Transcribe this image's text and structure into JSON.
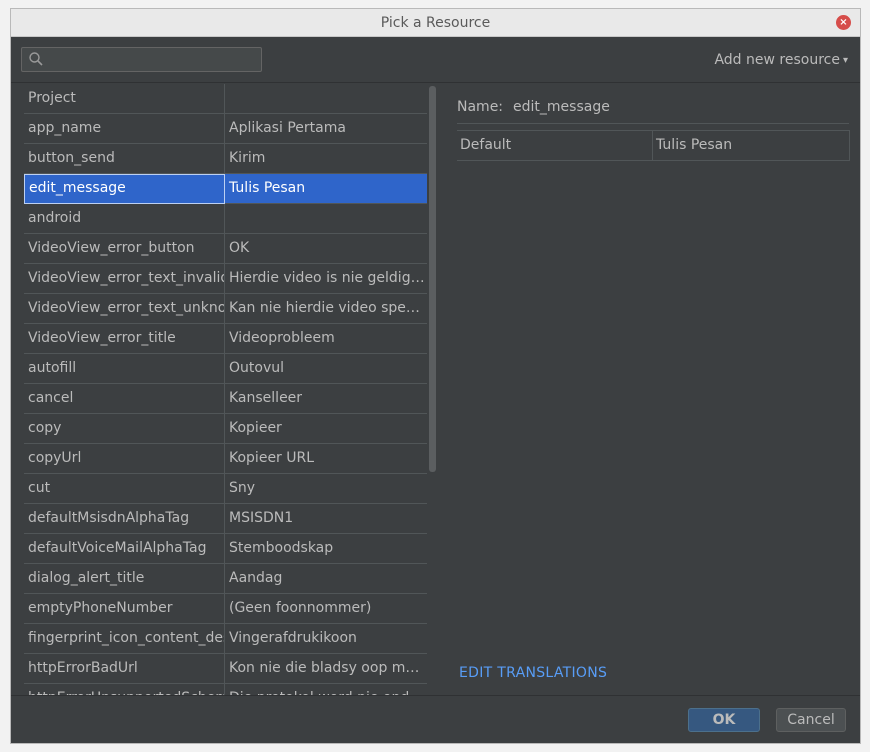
{
  "window": {
    "title": "Pick a Resource",
    "close_symbol": "×"
  },
  "search": {
    "placeholder": "",
    "value": ""
  },
  "add_resource_label": "Add new resource",
  "caret": "▾",
  "resource_table": {
    "group_header": "Project",
    "rows": [
      {
        "key": "app_name",
        "value": "Aplikasi Pertama"
      },
      {
        "key": "button_send",
        "value": "Kirim"
      },
      {
        "key": "edit_message",
        "value": "Tulis Pesan"
      },
      {
        "key": "android",
        "value": ""
      },
      {
        "key": "VideoView_error_button",
        "value": "OK"
      },
      {
        "key": "VideoView_error_text_invalid",
        "value": "Hierdie video is nie geldig ..."
      },
      {
        "key": "VideoView_error_text_unknown",
        "value": "Kan nie hierdie video spee..."
      },
      {
        "key": "VideoView_error_title",
        "value": "Videoprobleem"
      },
      {
        "key": "autofill",
        "value": "Outovul"
      },
      {
        "key": "cancel",
        "value": "Kanselleer"
      },
      {
        "key": "copy",
        "value": "Kopieer"
      },
      {
        "key": "copyUrl",
        "value": "Kopieer URL"
      },
      {
        "key": "cut",
        "value": "Sny"
      },
      {
        "key": "defaultMsisdnAlphaTag",
        "value": "MSISDN1"
      },
      {
        "key": "defaultVoiceMailAlphaTag",
        "value": "Stemboodskap"
      },
      {
        "key": "dialog_alert_title",
        "value": "Aandag"
      },
      {
        "key": "emptyPhoneNumber",
        "value": "(Geen foonnommer)"
      },
      {
        "key": "fingerprint_icon_content_description",
        "value": "Vingerafdrukikoon"
      },
      {
        "key": "httpErrorBadUrl",
        "value": "Kon nie die bladsy oop ma..."
      },
      {
        "key": "httpErrorUnsupportedScheme",
        "value": "Die protokol word nie ondersteun nie"
      }
    ],
    "selected_index": 2
  },
  "detail": {
    "name_label": "Name:",
    "name_value": "edit_message",
    "translations": [
      {
        "locale": "Default",
        "text": "Tulis Pesan"
      }
    ],
    "edit_translations_label": "EDIT TRANSLATIONS"
  },
  "buttons": {
    "ok": "OK",
    "cancel": "Cancel"
  },
  "colors": {
    "background": "#3c3f41",
    "selection": "#2f65ca",
    "link": "#589df6"
  }
}
